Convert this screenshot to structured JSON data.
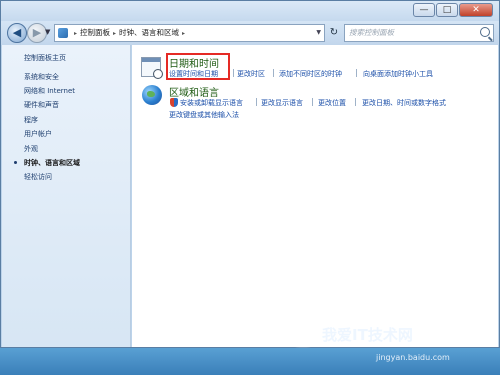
{
  "window": {
    "controls": {
      "minimize": "—",
      "maximize": "□",
      "close": "✕"
    }
  },
  "navigation": {
    "back_icon": "back-arrow-icon",
    "forward_icon": "forward-arrow-icon",
    "breadcrumbs": [
      "控制面板",
      "时钟、语言和区域"
    ],
    "search_placeholder": "搜索控制面板"
  },
  "sidebar": {
    "items": [
      {
        "label": "控制面板主页"
      },
      {
        "label": "系统和安全"
      },
      {
        "label": "网络和 Internet"
      },
      {
        "label": "硬件和声音"
      },
      {
        "label": "程序"
      },
      {
        "label": "用户帐户"
      },
      {
        "label": "外观"
      },
      {
        "label": "时钟、语言和区域",
        "current": true
      },
      {
        "label": "轻松访问"
      }
    ]
  },
  "main": {
    "datetime": {
      "title": "日期和时间",
      "links": [
        "设置时间和日期",
        "更改时区",
        "添加不同时区的时钟",
        "向桌面添加时钟小工具"
      ]
    },
    "region": {
      "title": "区域和语言",
      "links_row1": [
        "安装或卸载显示语言",
        "更改显示语言",
        "更改位置",
        "更改日期、时间或数字格式"
      ],
      "links_row2": [
        "更改键盘或其他输入法"
      ]
    }
  },
  "watermark": {
    "text": "我爱IT技术网",
    "url": "jingyan.baidu.com"
  },
  "colors": {
    "highlight_box": "#e52a25",
    "link": "#1a4ea8",
    "category_title": "#1e5a12"
  }
}
